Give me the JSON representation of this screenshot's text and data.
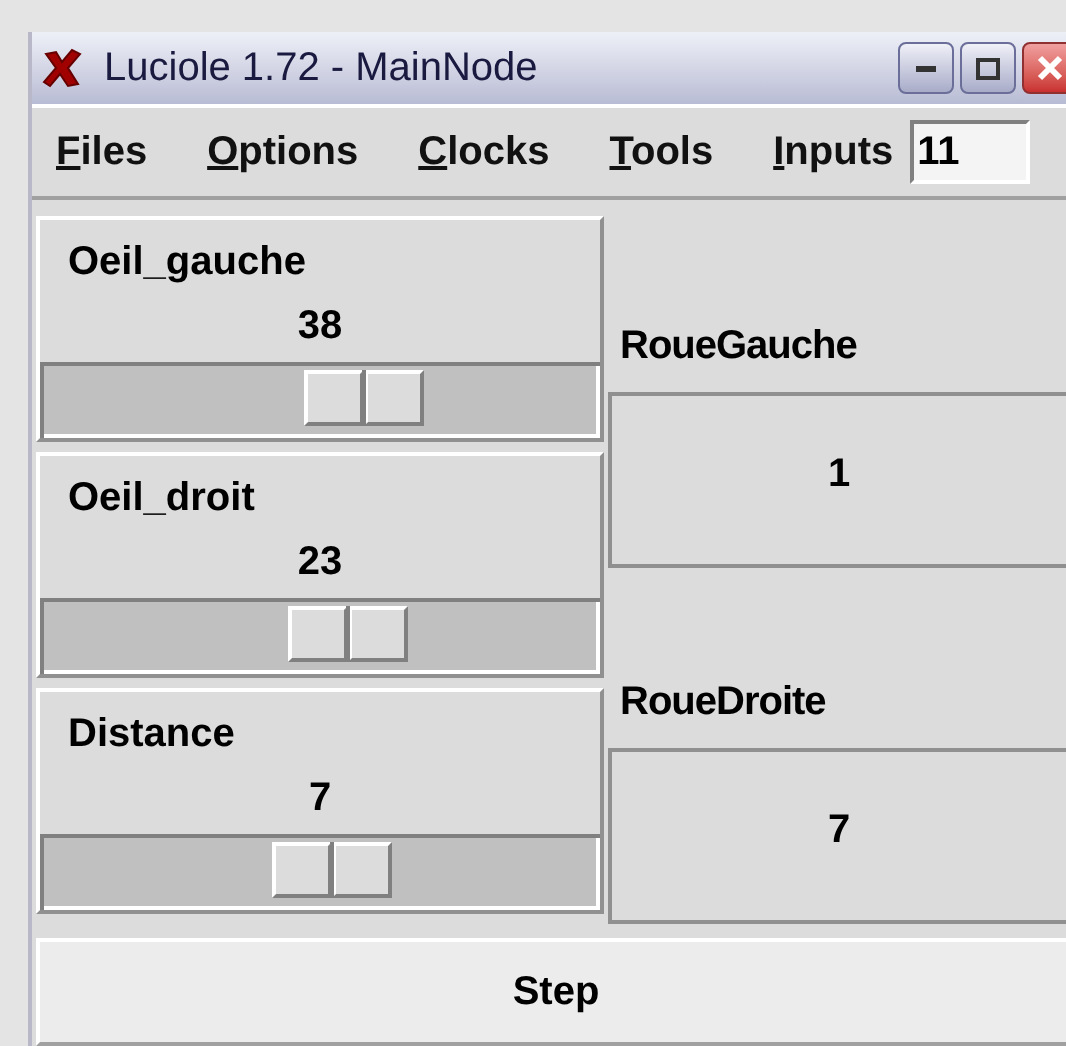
{
  "window": {
    "title": "Luciole 1.72 - MainNode"
  },
  "menu": [
    {
      "label": "Files"
    },
    {
      "label": "Options"
    },
    {
      "label": "Clocks"
    },
    {
      "label": "Tools"
    },
    {
      "label": "Inputs"
    }
  ],
  "menu_field": {
    "value": "11"
  },
  "inputs": [
    {
      "name": "Oeil_gauche",
      "value": "38",
      "level": 0.58
    },
    {
      "name": "Oeil_droit",
      "value": "23",
      "level": 0.55
    },
    {
      "name": "Distance",
      "value": "7",
      "level": 0.52
    }
  ],
  "outputs": [
    {
      "name": "RoueGauche",
      "value": "1"
    },
    {
      "name": "RoueDroite",
      "value": "7"
    }
  ],
  "step_button": {
    "label": "Step"
  }
}
